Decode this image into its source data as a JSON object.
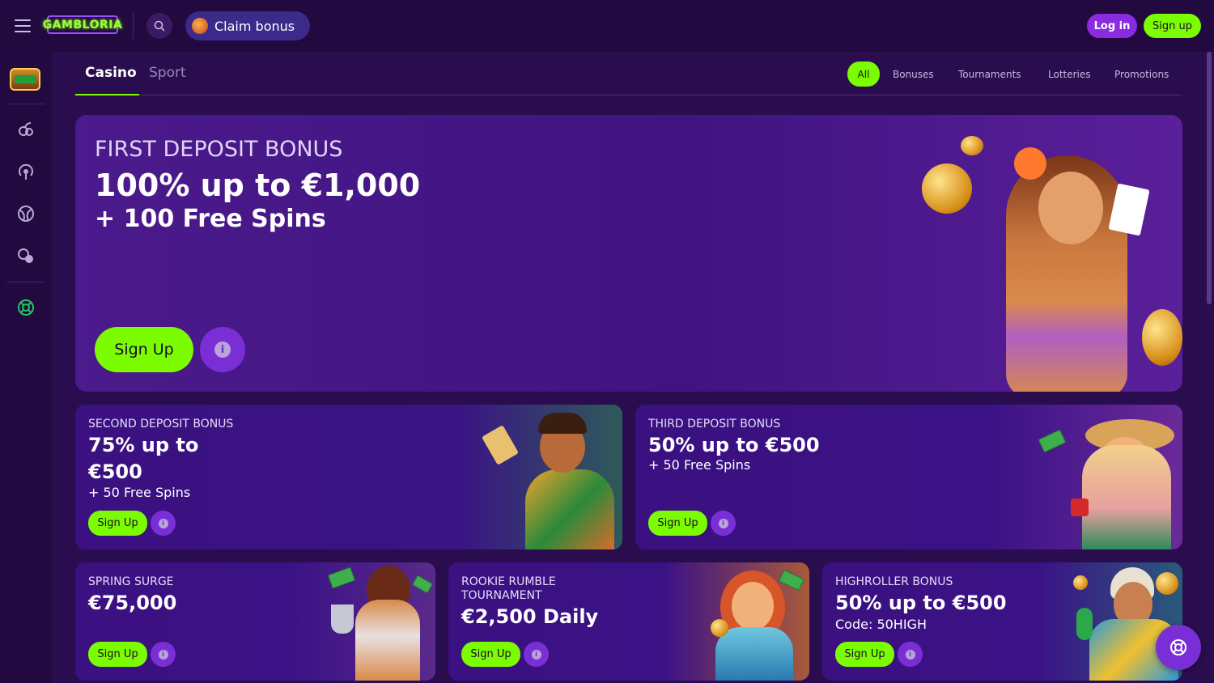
{
  "header": {
    "logo_text": "GAMBLORIA",
    "claim_bonus_label": "Claim bonus",
    "login_label": "Log in",
    "signup_label": "Sign up"
  },
  "tabs": {
    "casino": "Casino",
    "sport": "Sport",
    "active": "Casino"
  },
  "filters": [
    {
      "label": "All",
      "active": true
    },
    {
      "label": "Bonuses",
      "active": false
    },
    {
      "label": "Tournaments",
      "active": false
    },
    {
      "label": "Lotteries",
      "active": false
    },
    {
      "label": "Promotions",
      "active": false
    }
  ],
  "hero": {
    "subtitle": "FIRST DEPOSIT BONUS",
    "title": "100% up to €1,000",
    "title2": "+ 100 Free Spins",
    "signup_label": "Sign Up",
    "info_label": "i"
  },
  "cards": [
    {
      "subtitle": "SECOND DEPOSIT BONUS",
      "title_line1": "75% up to",
      "title_line2": "€500",
      "extra": "+ 50 Free Spins",
      "signup_label": "Sign Up",
      "info_label": "i"
    },
    {
      "subtitle": "THIRD DEPOSIT BONUS",
      "title_line1": "50% up to €500",
      "extra": "+ 50 Free Spins",
      "signup_label": "Sign Up",
      "info_label": "i"
    },
    {
      "subtitle": "SPRING SURGE",
      "title_line1": "€75,000",
      "signup_label": "Sign Up",
      "info_label": "i"
    },
    {
      "subtitle_line1": "ROOKIE RUMBLE",
      "subtitle_line2": "TOURNAMENT",
      "title_line1": "€2,500 Daily",
      "signup_label": "Sign Up",
      "info_label": "i"
    },
    {
      "subtitle": "HIGHROLLER BONUS",
      "title_line1": "50% up to €500",
      "extra": "Code: 50HIGH",
      "signup_label": "Sign Up",
      "info_label": "i"
    }
  ],
  "rail_icons": [
    "slots-logo-icon",
    "fruit-icon",
    "live-broadcast-icon",
    "sports-ball-icon",
    "gamepad-icon",
    "lifebuoy-icon"
  ],
  "colors": {
    "accent_green": "#7cfc00",
    "accent_purple": "#8a2be2",
    "background": "#2a0d4e"
  }
}
